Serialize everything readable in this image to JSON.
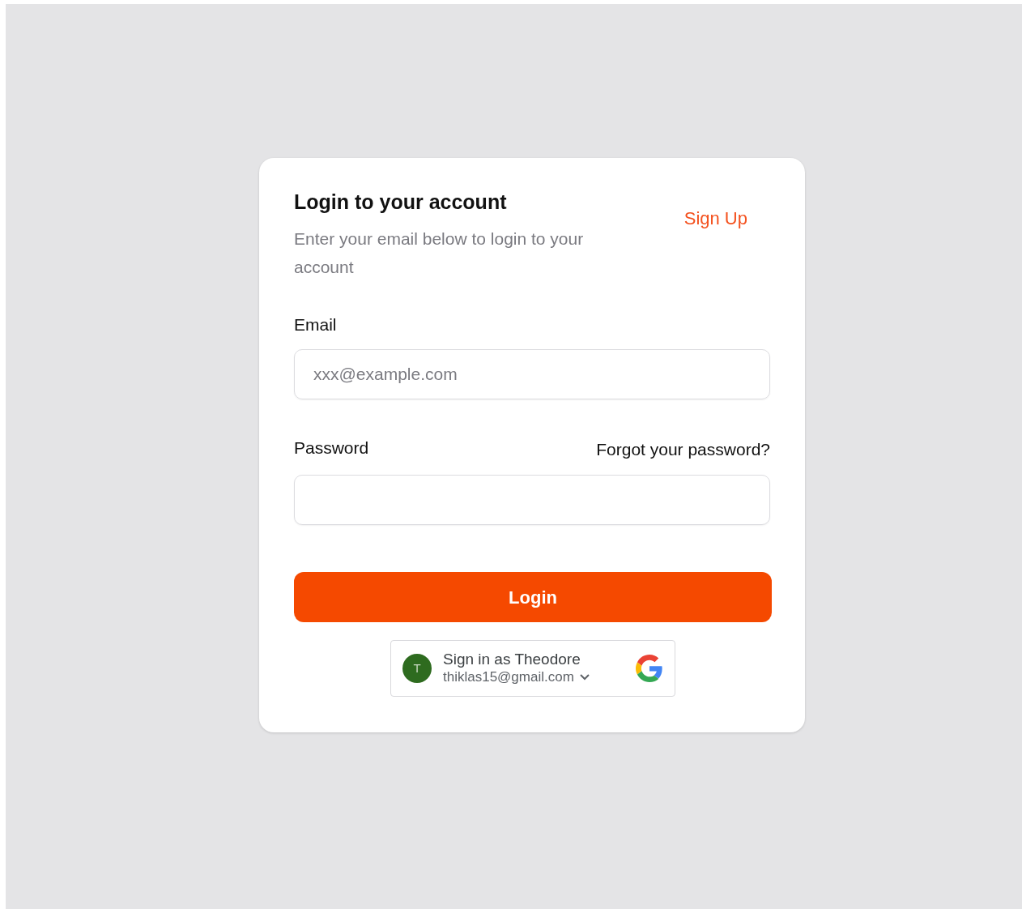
{
  "card": {
    "title": "Login to your account",
    "description": "Enter your email below to login to your account",
    "signup_link": "Sign Up"
  },
  "email": {
    "label": "Email",
    "placeholder": "xxx@example.com"
  },
  "password": {
    "label": "Password",
    "forgot_link": "Forgot your password?"
  },
  "login_button": "Login",
  "google_signin": {
    "avatar_initial": "T",
    "title": "Sign in as Theodore",
    "email": "thiklas15@gmail.com"
  }
}
